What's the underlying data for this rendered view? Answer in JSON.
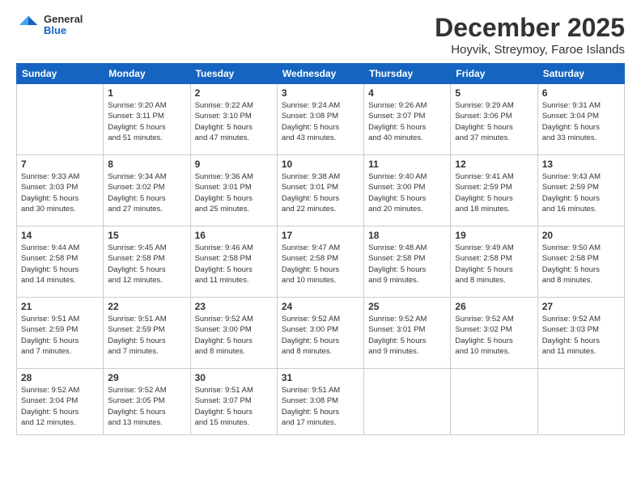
{
  "header": {
    "logo": {
      "general": "General",
      "blue": "Blue"
    },
    "title": "December 2025",
    "location": "Hoyvik, Streymoy, Faroe Islands"
  },
  "days_of_week": [
    "Sunday",
    "Monday",
    "Tuesday",
    "Wednesday",
    "Thursday",
    "Friday",
    "Saturday"
  ],
  "weeks": [
    [
      {
        "day": "",
        "info": ""
      },
      {
        "day": "1",
        "info": "Sunrise: 9:20 AM\nSunset: 3:11 PM\nDaylight: 5 hours\nand 51 minutes."
      },
      {
        "day": "2",
        "info": "Sunrise: 9:22 AM\nSunset: 3:10 PM\nDaylight: 5 hours\nand 47 minutes."
      },
      {
        "day": "3",
        "info": "Sunrise: 9:24 AM\nSunset: 3:08 PM\nDaylight: 5 hours\nand 43 minutes."
      },
      {
        "day": "4",
        "info": "Sunrise: 9:26 AM\nSunset: 3:07 PM\nDaylight: 5 hours\nand 40 minutes."
      },
      {
        "day": "5",
        "info": "Sunrise: 9:29 AM\nSunset: 3:06 PM\nDaylight: 5 hours\nand 37 minutes."
      },
      {
        "day": "6",
        "info": "Sunrise: 9:31 AM\nSunset: 3:04 PM\nDaylight: 5 hours\nand 33 minutes."
      }
    ],
    [
      {
        "day": "7",
        "info": "Sunrise: 9:33 AM\nSunset: 3:03 PM\nDaylight: 5 hours\nand 30 minutes."
      },
      {
        "day": "8",
        "info": "Sunrise: 9:34 AM\nSunset: 3:02 PM\nDaylight: 5 hours\nand 27 minutes."
      },
      {
        "day": "9",
        "info": "Sunrise: 9:36 AM\nSunset: 3:01 PM\nDaylight: 5 hours\nand 25 minutes."
      },
      {
        "day": "10",
        "info": "Sunrise: 9:38 AM\nSunset: 3:01 PM\nDaylight: 5 hours\nand 22 minutes."
      },
      {
        "day": "11",
        "info": "Sunrise: 9:40 AM\nSunset: 3:00 PM\nDaylight: 5 hours\nand 20 minutes."
      },
      {
        "day": "12",
        "info": "Sunrise: 9:41 AM\nSunset: 2:59 PM\nDaylight: 5 hours\nand 18 minutes."
      },
      {
        "day": "13",
        "info": "Sunrise: 9:43 AM\nSunset: 2:59 PM\nDaylight: 5 hours\nand 16 minutes."
      }
    ],
    [
      {
        "day": "14",
        "info": "Sunrise: 9:44 AM\nSunset: 2:58 PM\nDaylight: 5 hours\nand 14 minutes."
      },
      {
        "day": "15",
        "info": "Sunrise: 9:45 AM\nSunset: 2:58 PM\nDaylight: 5 hours\nand 12 minutes."
      },
      {
        "day": "16",
        "info": "Sunrise: 9:46 AM\nSunset: 2:58 PM\nDaylight: 5 hours\nand 11 minutes."
      },
      {
        "day": "17",
        "info": "Sunrise: 9:47 AM\nSunset: 2:58 PM\nDaylight: 5 hours\nand 10 minutes."
      },
      {
        "day": "18",
        "info": "Sunrise: 9:48 AM\nSunset: 2:58 PM\nDaylight: 5 hours\nand 9 minutes."
      },
      {
        "day": "19",
        "info": "Sunrise: 9:49 AM\nSunset: 2:58 PM\nDaylight: 5 hours\nand 8 minutes."
      },
      {
        "day": "20",
        "info": "Sunrise: 9:50 AM\nSunset: 2:58 PM\nDaylight: 5 hours\nand 8 minutes."
      }
    ],
    [
      {
        "day": "21",
        "info": "Sunrise: 9:51 AM\nSunset: 2:59 PM\nDaylight: 5 hours\nand 7 minutes."
      },
      {
        "day": "22",
        "info": "Sunrise: 9:51 AM\nSunset: 2:59 PM\nDaylight: 5 hours\nand 7 minutes."
      },
      {
        "day": "23",
        "info": "Sunrise: 9:52 AM\nSunset: 3:00 PM\nDaylight: 5 hours\nand 8 minutes."
      },
      {
        "day": "24",
        "info": "Sunrise: 9:52 AM\nSunset: 3:00 PM\nDaylight: 5 hours\nand 8 minutes."
      },
      {
        "day": "25",
        "info": "Sunrise: 9:52 AM\nSunset: 3:01 PM\nDaylight: 5 hours\nand 9 minutes."
      },
      {
        "day": "26",
        "info": "Sunrise: 9:52 AM\nSunset: 3:02 PM\nDaylight: 5 hours\nand 10 minutes."
      },
      {
        "day": "27",
        "info": "Sunrise: 9:52 AM\nSunset: 3:03 PM\nDaylight: 5 hours\nand 11 minutes."
      }
    ],
    [
      {
        "day": "28",
        "info": "Sunrise: 9:52 AM\nSunset: 3:04 PM\nDaylight: 5 hours\nand 12 minutes."
      },
      {
        "day": "29",
        "info": "Sunrise: 9:52 AM\nSunset: 3:05 PM\nDaylight: 5 hours\nand 13 minutes."
      },
      {
        "day": "30",
        "info": "Sunrise: 9:51 AM\nSunset: 3:07 PM\nDaylight: 5 hours\nand 15 minutes."
      },
      {
        "day": "31",
        "info": "Sunrise: 9:51 AM\nSunset: 3:08 PM\nDaylight: 5 hours\nand 17 minutes."
      },
      {
        "day": "",
        "info": ""
      },
      {
        "day": "",
        "info": ""
      },
      {
        "day": "",
        "info": ""
      }
    ]
  ]
}
